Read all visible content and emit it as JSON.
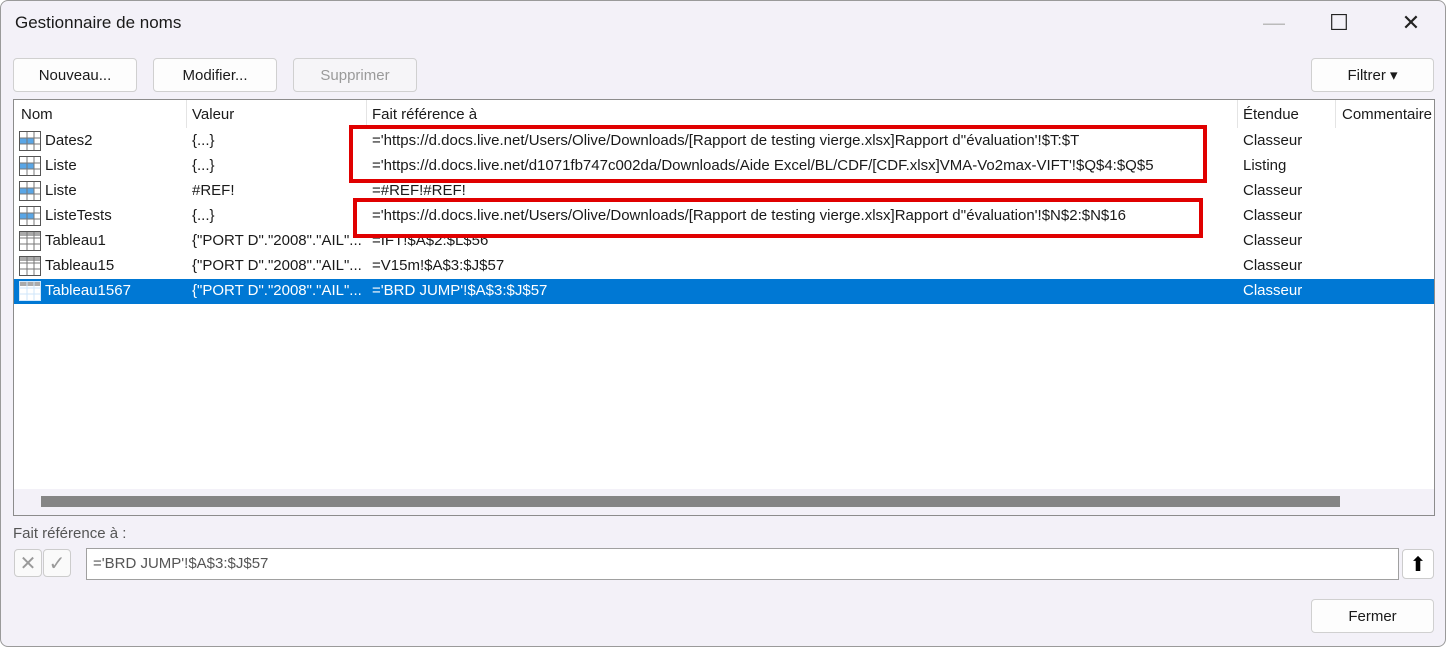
{
  "window": {
    "title": "Gestionnaire de noms",
    "minimize": "—",
    "maximize": "☐",
    "close": "✕"
  },
  "toolbar": {
    "new": "Nouveau...",
    "edit": "Modifier...",
    "delete": "Supprimer",
    "filter": "Filtrer ▾"
  },
  "columns": [
    "Nom",
    "Valeur",
    "Fait référence à",
    "Étendue",
    "Commentaire"
  ],
  "rows": [
    {
      "name": "Dates2",
      "value": "{...}",
      "ref": "='https://d.docs.live.net/Users/Olive/Downloads/[Rapport de testing vierge.xlsx]Rapport d''évaluation'!$T:$T",
      "scope": "Classeur",
      "icon": "named-range-icon"
    },
    {
      "name": "Liste",
      "value": "{...}",
      "ref": "='https://d.docs.live.net/d1071fb747c002da/Downloads/Aide Excel/BL/CDF/[CDF.xlsx]VMA-Vo2max-VIFT'!$Q$4:$Q$5",
      "scope": "Listing",
      "icon": "named-range-icon"
    },
    {
      "name": "Liste",
      "value": "#REF!",
      "ref": "=#REF!#REF!",
      "scope": "Classeur",
      "icon": "named-range-icon"
    },
    {
      "name": "ListeTests",
      "value": "{...}",
      "ref": "='https://d.docs.live.net/Users/Olive/Downloads/[Rapport de testing vierge.xlsx]Rapport d''évaluation'!$N$2:$N$16",
      "scope": "Classeur",
      "icon": "named-range-icon"
    },
    {
      "name": "Tableau1",
      "value": "{\"PORT D\".\"2008\".\"AIL\"...",
      "ref": "=IFT!$A$2:$L$56",
      "scope": "Classeur",
      "icon": "table-icon"
    },
    {
      "name": "Tableau15",
      "value": "{\"PORT D\".\"2008\".\"AIL\"...",
      "ref": "=V15m!$A$3:$J$57",
      "scope": "Classeur",
      "icon": "table-icon"
    },
    {
      "name": "Tableau1567",
      "value": "{\"PORT D\".\"2008\".\"AIL\"...",
      "ref": "='BRD JUMP'!$A$3:$J$57",
      "scope": "Classeur",
      "icon": "table-icon",
      "selected": true
    }
  ],
  "bottom": {
    "label": "Fait référence à :",
    "ref_value": "='BRD JUMP'!$A$3:$J$57",
    "cancel": "✕",
    "confirm": "✓",
    "collapse": "⬆",
    "close": "Fermer"
  },
  "colors": {
    "selection": "#0078d4",
    "highlight": "#e00000"
  }
}
